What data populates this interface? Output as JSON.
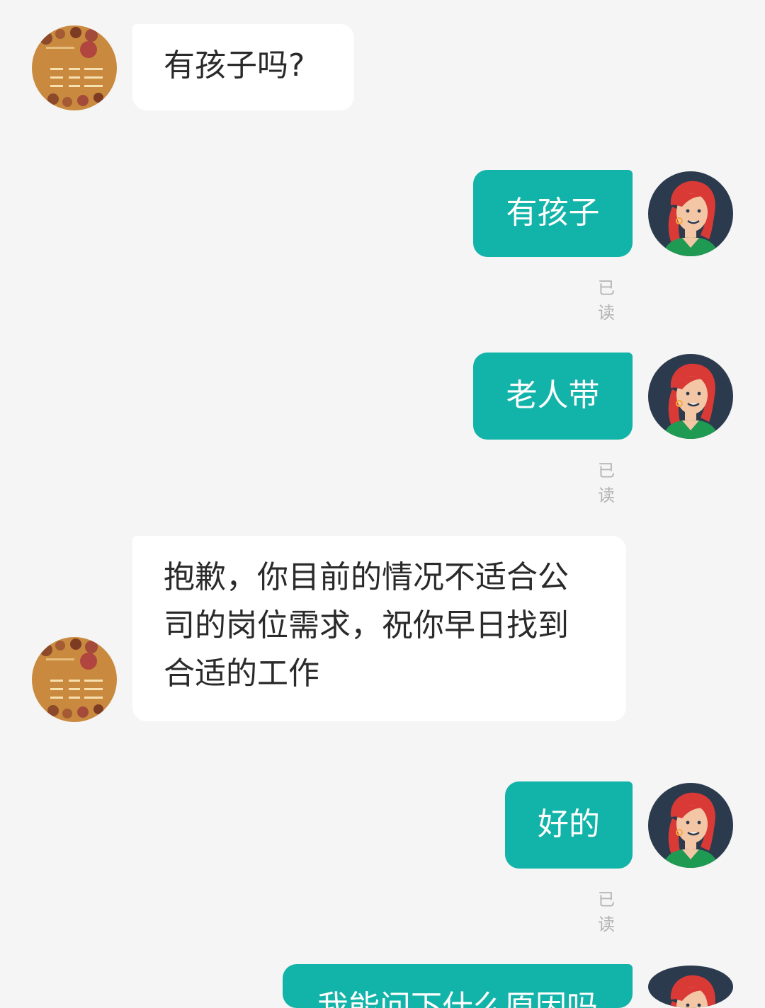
{
  "colors": {
    "background": "#f5f5f5",
    "outgoing_bubble": "#12b3a8",
    "incoming_bubble": "#ffffff",
    "read_text": "#b3b3b3"
  },
  "messages": [
    {
      "side": "in",
      "text": "有孩子吗?",
      "avatar": "recruiter-avatar"
    },
    {
      "side": "out",
      "text": "有孩子",
      "status": "已读",
      "avatar": "user-avatar"
    },
    {
      "side": "out",
      "text": "老人带",
      "status": "已读",
      "avatar": "user-avatar"
    },
    {
      "side": "in",
      "text": "抱歉，你目前的情况不适合公\n司的岗位需求，祝你早日找到\n合适的工作",
      "avatar": "recruiter-avatar"
    },
    {
      "side": "out",
      "text": "好的",
      "status": "已读",
      "avatar": "user-avatar"
    },
    {
      "side": "out",
      "text": "我能问下什么原因吗",
      "avatar": "user-avatar"
    }
  ]
}
